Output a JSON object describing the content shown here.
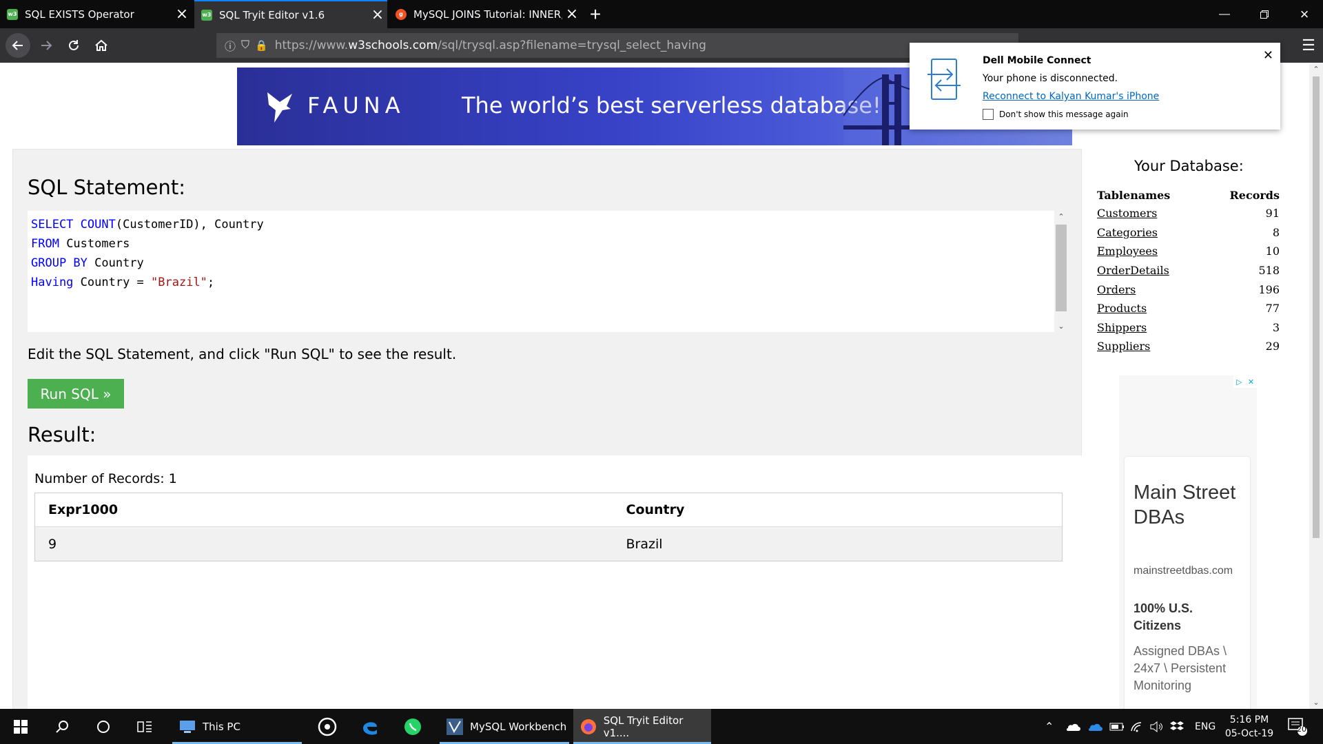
{
  "browser": {
    "tabs": [
      {
        "title": "SQL EXISTS Operator",
        "favicon": "w3schools-icon",
        "active": false
      },
      {
        "title": "SQL Tryit Editor v1.6",
        "favicon": "w3schools-icon",
        "active": true
      },
      {
        "title": "MySQL JOINS Tutorial: INNER, ...",
        "favicon": "guru99-icon",
        "active": false
      }
    ],
    "url_prefix": "https://www.",
    "url_host": "w3schools.com",
    "url_path": "/sql/trysql.asp?filename=trysql_select_having"
  },
  "ad_banner": {
    "brand": "FAUNA",
    "tagline": "The world’s best serverless database!"
  },
  "editor": {
    "heading": "SQL Statement:",
    "code_lines": [
      [
        {
          "t": "SELECT ",
          "k": "kw"
        },
        {
          "t": "COUNT",
          "k": "kw"
        },
        {
          "t": "(CustomerID), Country",
          "k": ""
        }
      ],
      [
        {
          "t": "FROM ",
          "k": "kw"
        },
        {
          "t": "Customers",
          "k": ""
        }
      ],
      [
        {
          "t": "GROUP BY ",
          "k": "kw"
        },
        {
          "t": "Country",
          "k": ""
        }
      ],
      [
        {
          "t": "Having ",
          "k": "kw"
        },
        {
          "t": "Country = ",
          "k": ""
        },
        {
          "t": "\"Brazil\"",
          "k": "str"
        },
        {
          "t": ";",
          "k": ""
        }
      ]
    ],
    "hint": "Edit the SQL Statement, and click \"Run SQL\" to see the result.",
    "run_label": "Run SQL »"
  },
  "result": {
    "heading": "Result:",
    "num_records": "Number of Records: 1",
    "columns": [
      "Expr1000",
      "Country"
    ],
    "rows": [
      [
        "9",
        "Brazil"
      ]
    ]
  },
  "database": {
    "title": "Your Database:",
    "col_name": "Tablenames",
    "col_records": "Records",
    "tables": [
      {
        "name": "Customers",
        "records": "91"
      },
      {
        "name": "Categories",
        "records": "8"
      },
      {
        "name": "Employees",
        "records": "10"
      },
      {
        "name": "OrderDetails",
        "records": "518"
      },
      {
        "name": "Orders",
        "records": "196"
      },
      {
        "name": "Products",
        "records": "77"
      },
      {
        "name": "Shippers",
        "records": "3"
      },
      {
        "name": "Suppliers",
        "records": "29"
      }
    ]
  },
  "side_ad": {
    "title": "Main Street DBAs",
    "domain": "mainstreetdbas.com",
    "line1": "100% U.S. Citizens",
    "line2": "Assigned DBAs \\ 24x7 \\ Persistent Monitoring"
  },
  "notification": {
    "title": "Dell Mobile Connect",
    "body": "Your phone is disconnected.",
    "link": "Reconnect to Kalyan Kumar's iPhone",
    "checkbox": "Don't show this message again"
  },
  "taskbar": {
    "apps": [
      {
        "label": "This PC",
        "icon": "this-pc-icon",
        "active": false
      },
      {
        "label": "MySQL Workbench",
        "icon": "mysql-workbench-icon",
        "active": false
      },
      {
        "label": "SQL Tryit Editor v1....",
        "icon": "firefox-icon",
        "active": true
      }
    ],
    "language": "ENG",
    "time": "5:16 PM",
    "date": "05-Oct-19",
    "notifications_count": "20"
  }
}
